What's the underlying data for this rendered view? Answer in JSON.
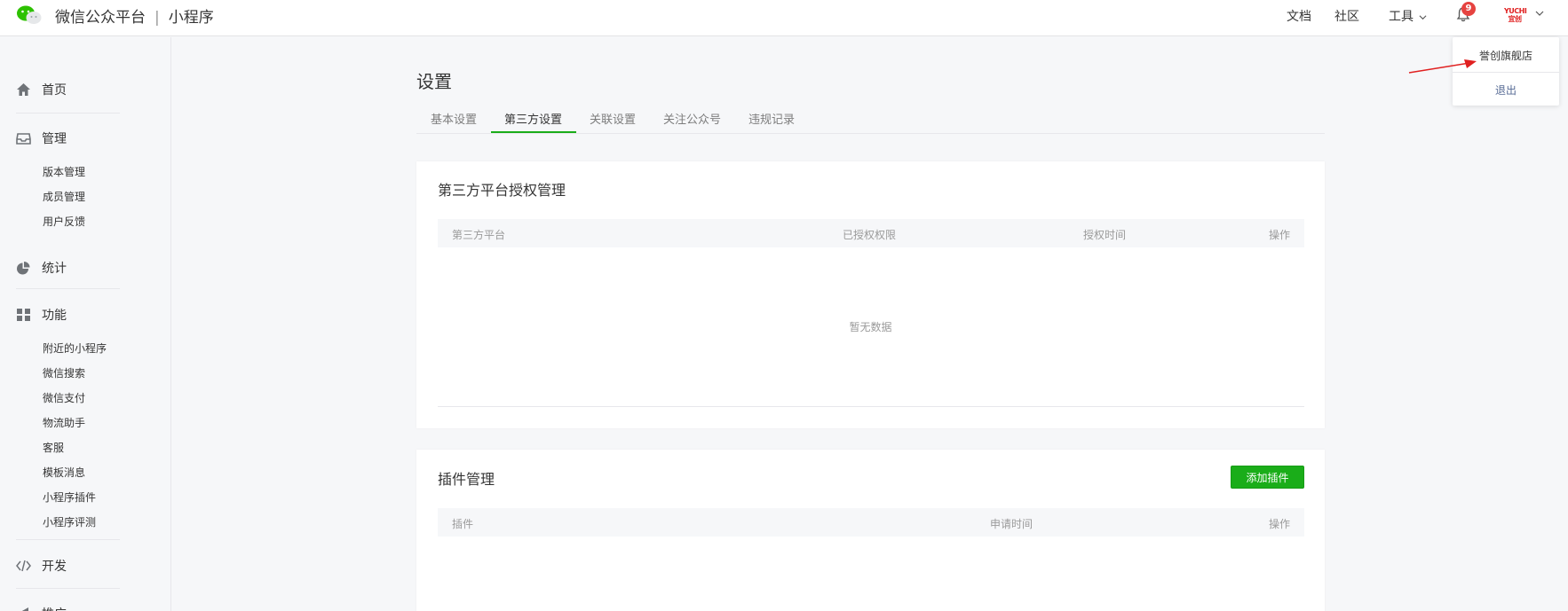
{
  "header": {
    "brand": "微信公众平台",
    "separator": "|",
    "product": "小程序",
    "nav": [
      "文档",
      "社区",
      "工具"
    ],
    "notification_count": "9",
    "avatar_text": "YUCHI 宜创"
  },
  "account_menu": {
    "name": "誉创旗舰店",
    "logout": "退出"
  },
  "sidebar": {
    "home": "首页",
    "manage": {
      "label": "管理",
      "items": [
        "版本管理",
        "成员管理",
        "用户反馈"
      ]
    },
    "stats": "统计",
    "features": {
      "label": "功能",
      "items": [
        "附近的小程序",
        "微信搜索",
        "微信支付",
        "物流助手",
        "客服",
        "模板消息",
        "小程序插件",
        "小程序评测"
      ]
    },
    "dev": "开发",
    "promo": "推广"
  },
  "main": {
    "title": "设置",
    "tabs": [
      "基本设置",
      "第三方设置",
      "关联设置",
      "关注公众号",
      "违规记录"
    ],
    "active_tab": "第三方设置",
    "auth_card": {
      "title": "第三方平台授权管理",
      "columns": [
        "第三方平台",
        "已授权权限",
        "授权时间",
        "操作"
      ],
      "empty": "暂无数据"
    },
    "plugin_card": {
      "title": "插件管理",
      "add_button": "添加插件",
      "columns": [
        "插件",
        "申请时间",
        "操作"
      ]
    }
  },
  "colors": {
    "accent": "#1aad19",
    "link": "#576b95",
    "badge": "#e64340",
    "annotation": "#e02020"
  }
}
